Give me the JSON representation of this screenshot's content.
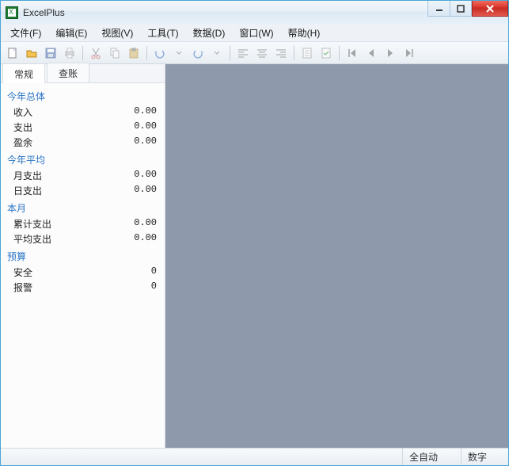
{
  "title": "ExcelPlus",
  "menu": {
    "file": "文件(F)",
    "edit": "编辑(E)",
    "view": "视图(V)",
    "tools": "工具(T)",
    "data": "数据(D)",
    "window": "窗口(W)",
    "help": "帮助(H)"
  },
  "toolbar": {
    "new": "new",
    "open": "open",
    "save": "save",
    "print": "print",
    "cut": "cut",
    "copy": "copy",
    "paste": "paste",
    "undo": "undo",
    "redo": "redo",
    "alignL": "align-left",
    "alignC": "align-center",
    "alignR": "align-right",
    "doc1": "doc1",
    "doc2": "doc2",
    "first": "first",
    "prev": "prev",
    "next": "next",
    "last": "last"
  },
  "sidebar": {
    "tabs": {
      "general": "常规",
      "ledger": "查账"
    },
    "groups": [
      {
        "header": "今年总体",
        "rows": [
          {
            "label": "收入",
            "value": "0.00"
          },
          {
            "label": "支出",
            "value": "0.00"
          },
          {
            "label": "盈余",
            "value": "0.00"
          }
        ]
      },
      {
        "header": "今年平均",
        "rows": [
          {
            "label": "月支出",
            "value": "0.00"
          },
          {
            "label": "日支出",
            "value": "0.00"
          }
        ]
      },
      {
        "header": "本月",
        "rows": [
          {
            "label": "累计支出",
            "value": "0.00"
          },
          {
            "label": "平均支出",
            "value": "0.00"
          }
        ]
      },
      {
        "header": "预算",
        "rows": [
          {
            "label": "安全",
            "value": "0"
          },
          {
            "label": "报警",
            "value": "0"
          }
        ]
      }
    ]
  },
  "statusbar": {
    "mode": "全自动",
    "numlock": "数字"
  }
}
